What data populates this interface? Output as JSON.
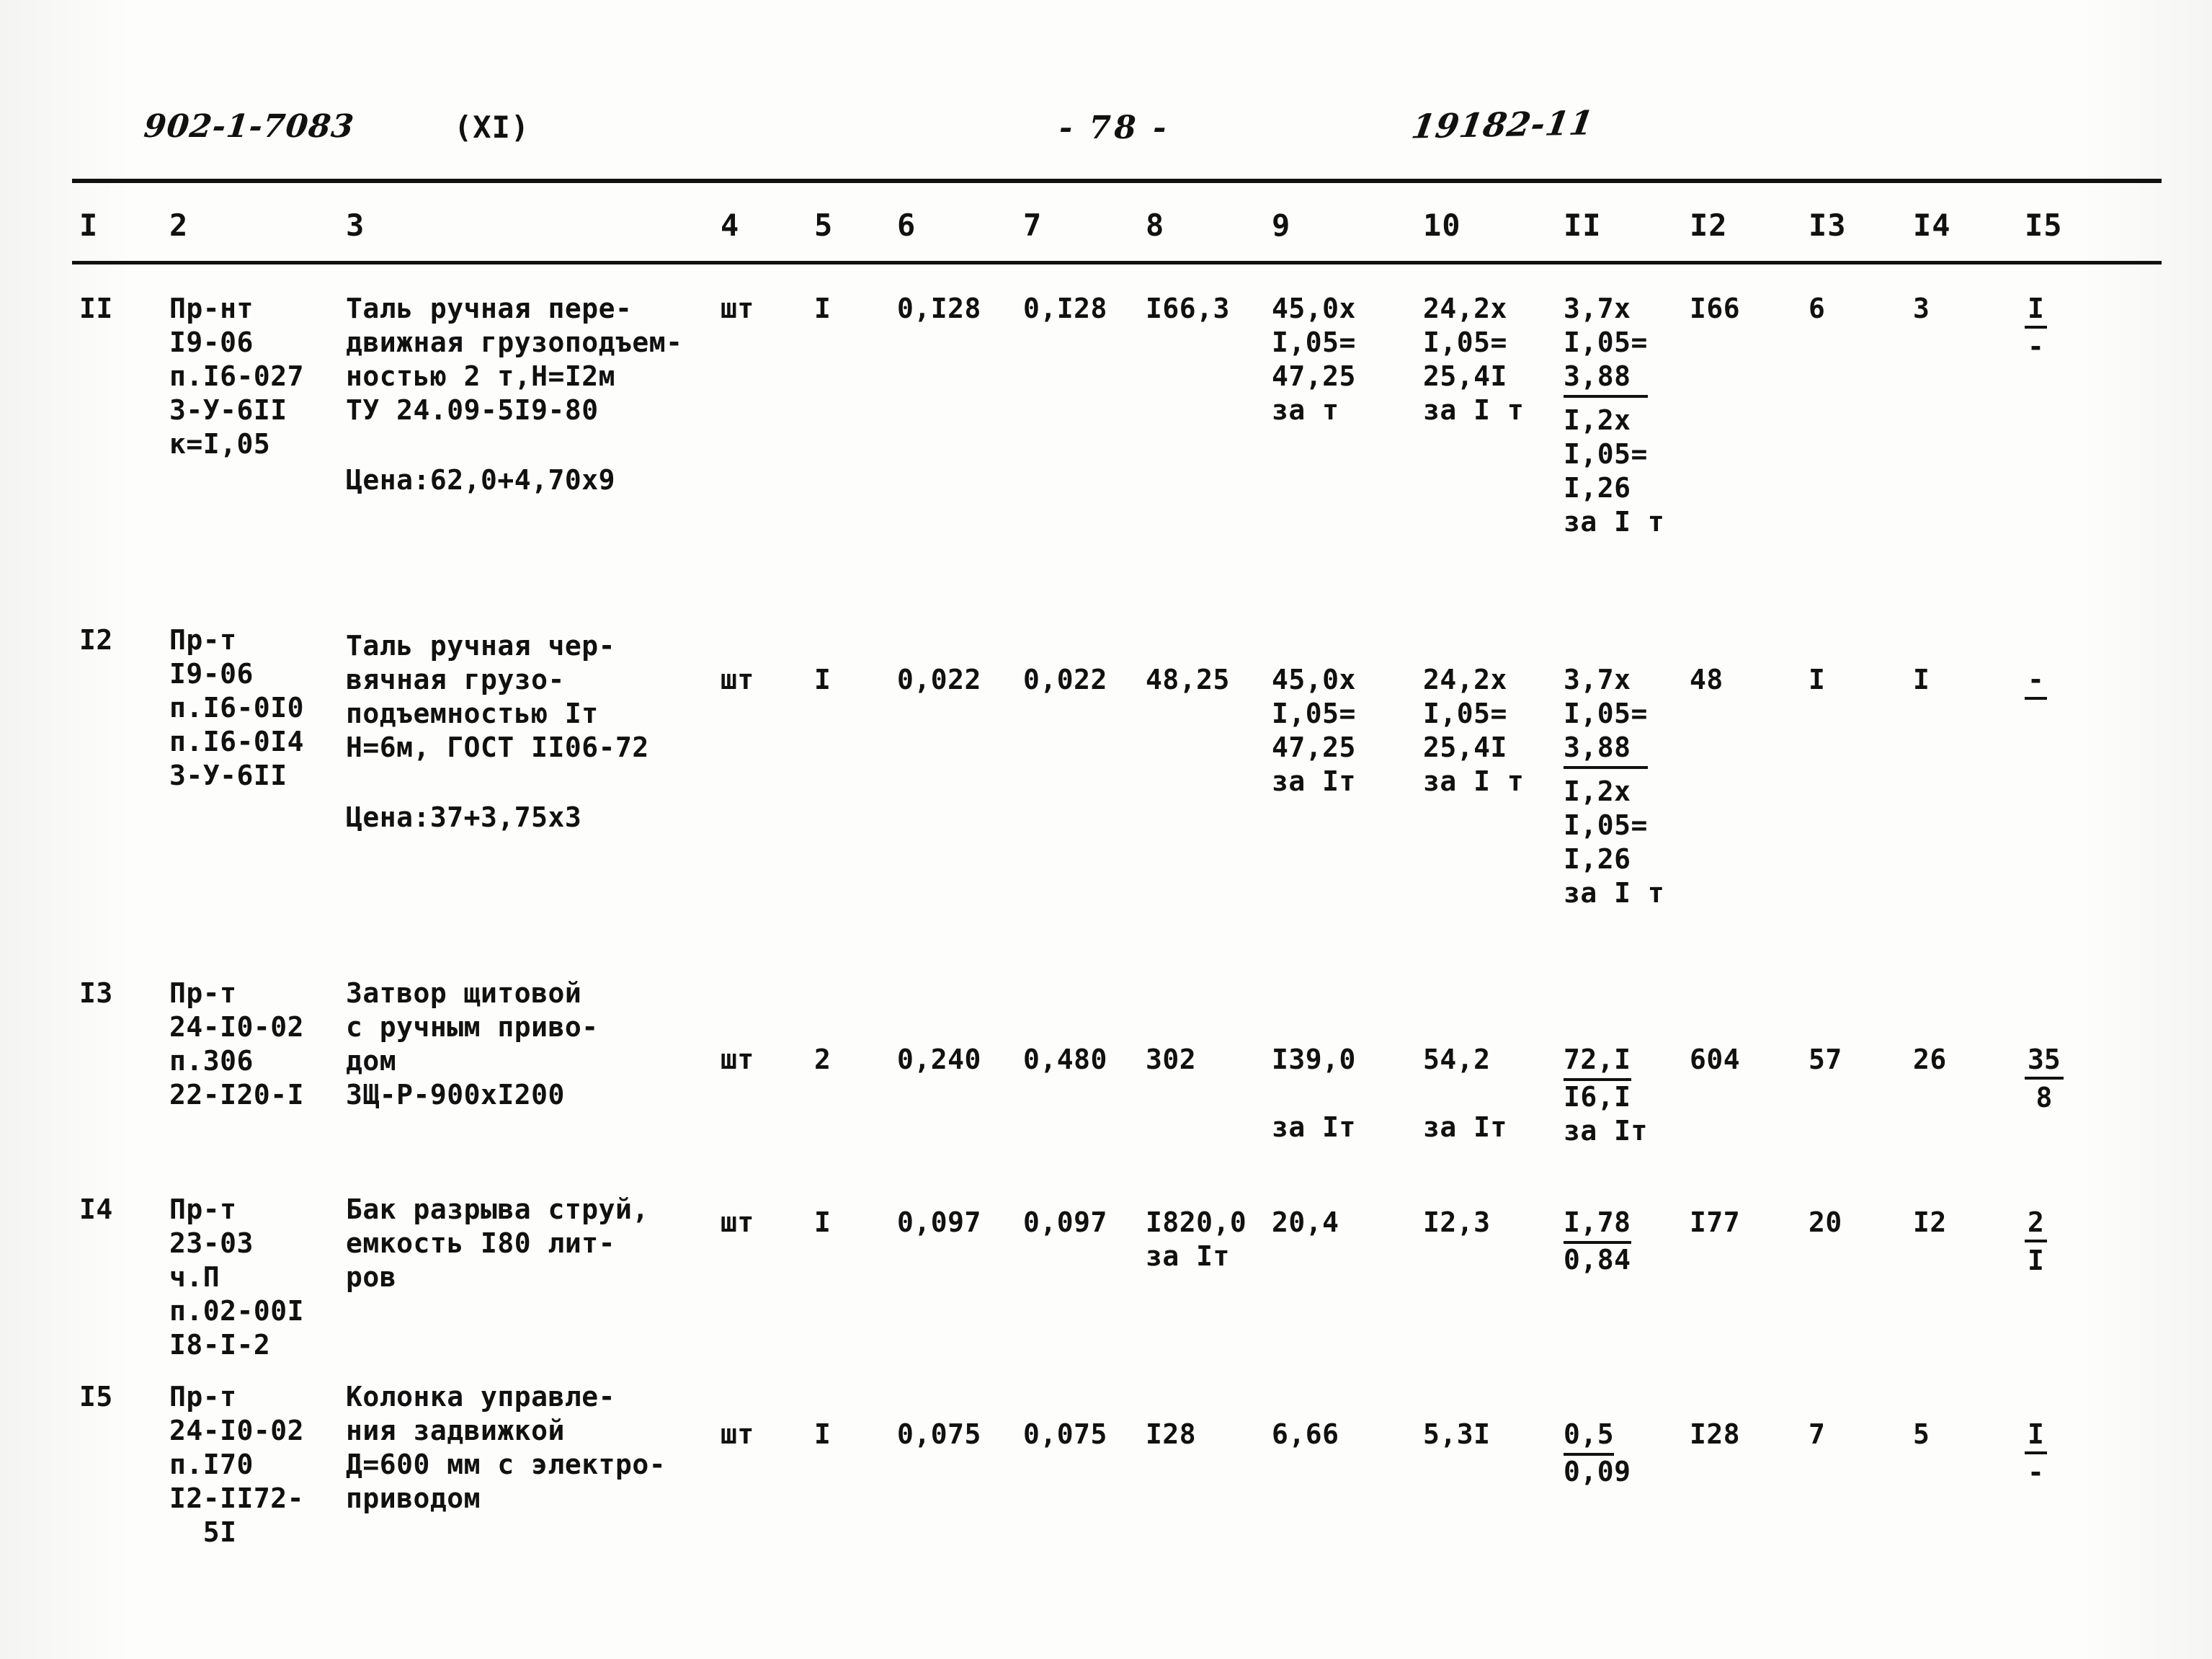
{
  "header": {
    "doc_code": "902-1-7083",
    "part": "(XI)",
    "page_number": "- 78 -",
    "stamp": "19182-11"
  },
  "table": {
    "column_headers": [
      "I",
      "2",
      "3",
      "4",
      "5",
      "6",
      "7",
      "8",
      "9",
      "10",
      "II",
      "I2",
      "I3",
      "I4",
      "I5"
    ],
    "rows": [
      {
        "c1": "II",
        "c2": "Пр-нт\nI9-06\nп.I6-027\n3-У-6II\nк=I,05",
        "c3_lines": "Таль ручная пере-\nдвижная грузоподъем-\nностью 2 т,H=I2м\nТУ 24.09-5I9-80",
        "c3_price": "Цена:62,0+4,70х9",
        "c4": "шт",
        "c5": "I",
        "c6": "0,I28",
        "c7": "0,I28",
        "c8": "I66,3",
        "c9": "45,0х\nI,05=\n47,25\nза т",
        "c10": "24,2х\nI,05=\n25,4I\nза I т",
        "c11": "3,7х\nI,05=\n3,88",
        "c11b": "I,2х\nI,05=\nI,26\nза I т",
        "c12": "I66",
        "c13": "6",
        "c14": "3",
        "c15_top": "I",
        "c15_bot": "-"
      },
      {
        "c1": "I2",
        "c2": "Пр-т\nI9-06\nп.I6-0I0\nп.I6-0I4\n3-У-6II",
        "c3_lines": "Таль ручная чер-\nвячная грузо-\nподъемностью Iт\nH=6м, ГОСТ II06-72",
        "c3_price": "Цена:37+3,75х3",
        "c4": "шт",
        "c5": "I",
        "c6": "0,022",
        "c7": "0,022",
        "c8": "48,25",
        "c9": "45,0х\nI,05=\n47,25\nза Iт",
        "c10": "24,2х\nI,05=\n25,4I\nза I т",
        "c11": "3,7х\nI,05=\n3,88",
        "c11b": "I,2х\nI,05=\nI,26\nза I т",
        "c12": "48",
        "c13": "I",
        "c14": "I",
        "c15_top": "-",
        "c15_bot": ""
      },
      {
        "c1": "I3",
        "c2": "Пр-т\n24-I0-02\nп.306\n22-I20-I",
        "c3_lines": "Затвор щитовой\nс ручным приво-\nдом\nЗЩ-Р-900хI200",
        "c3_price": "",
        "c4": "шт",
        "c5": "2",
        "c6": "0,240",
        "c7": "0,480",
        "c8": "302",
        "c9": "I39,0\n\nза Iт",
        "c10": "54,2\n\nза Iт",
        "c11": "72,I",
        "c11b": "I6,I\nза Iт",
        "c12": "604",
        "c13": "57",
        "c14": "26",
        "c15_top": "35",
        "c15_bot": "8"
      },
      {
        "c1": "I4",
        "c2": "Пр-т\n23-03\nч.П\nп.02-00I\nI8-I-2",
        "c3_lines": "Бак разрыва струй,\nемкость I80 лит-\nров",
        "c3_price": "",
        "c4": "шт",
        "c5": "I",
        "c6": "0,097",
        "c7": "0,097",
        "c8": "I820,0\nза Iт",
        "c9": "20,4",
        "c10": "I2,3",
        "c11": "I,78",
        "c11b": "0,84",
        "c12": "I77",
        "c13": "20",
        "c14": "I2",
        "c15_top": "2",
        "c15_bot": "I"
      },
      {
        "c1": "I5",
        "c2": "Пр-т\n24-I0-02\nп.I70\nI2-II72-\n  5I",
        "c3_lines": "Колонка управле-\nния задвижкой\nД=600 мм с электро-\nприводом",
        "c3_price": "",
        "c4": "шт",
        "c5": "I",
        "c6": "0,075",
        "c7": "0,075",
        "c8": "I28",
        "c9": "6,66",
        "c10": "5,3I",
        "c11": "0,5",
        "c11b": "0,09",
        "c12": "I28",
        "c13": "7",
        "c14": "5",
        "c15_top": "I",
        "c15_bot": "-"
      }
    ]
  }
}
